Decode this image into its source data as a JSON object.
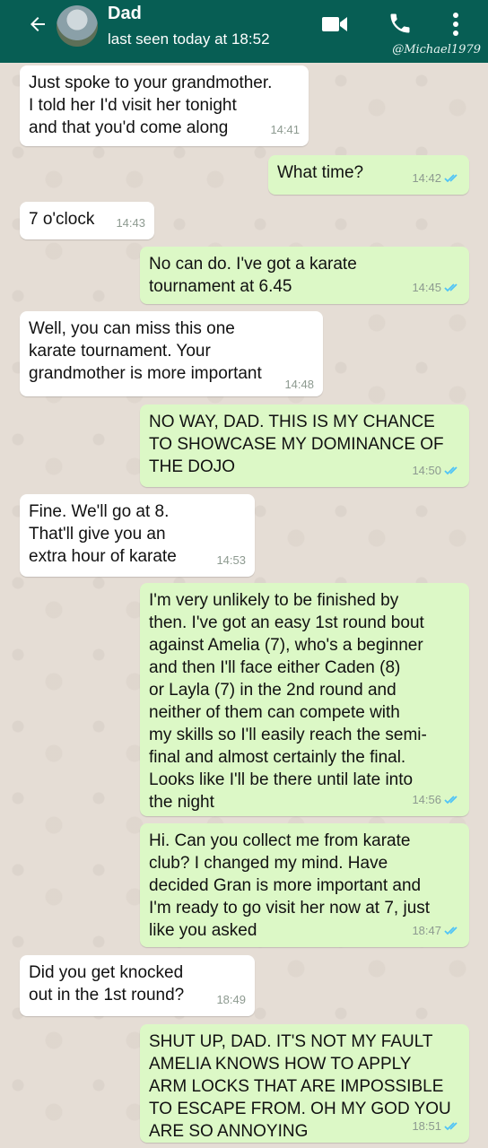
{
  "header": {
    "contact_name": "Dad",
    "status": "last seen today at 18:52",
    "watermark": "@Michael1979",
    "icons": [
      "back-arrow-icon",
      "avatar",
      "video-call-icon",
      "phone-icon",
      "more-options-icon"
    ]
  },
  "colors": {
    "header_bg": "#075e54",
    "chat_bg": "#e5ddd5",
    "incoming_bubble": "#ffffff",
    "outgoing_bubble": "#dcf8c6",
    "read_ticks": "#4fc3f7"
  },
  "messages": [
    {
      "dir": "in",
      "text": "Just spoke to your grandmother.\nI told her I'd visit her tonight\nand that you'd come along",
      "time": "14:41"
    },
    {
      "dir": "out",
      "text": "What time?",
      "time": "14:42",
      "read": true
    },
    {
      "dir": "in",
      "text": "7 o'clock",
      "time": "14:43"
    },
    {
      "dir": "out",
      "text": "No can do. I've got a karate\ntournament at 6.45",
      "time": "14:45",
      "read": true
    },
    {
      "dir": "in",
      "text": "Well, you can miss this one\nkarate tournament. Your\ngrandmother is more important",
      "time": "14:48"
    },
    {
      "dir": "out",
      "text": "NO WAY, DAD. THIS IS MY CHANCE\nTO SHOWCASE MY DOMINANCE OF\nTHE DOJO",
      "time": "14:50",
      "read": true
    },
    {
      "dir": "in",
      "text": "Fine. We'll go at 8.\nThat'll give you an\nextra hour of karate",
      "time": "14:53"
    },
    {
      "dir": "out",
      "text": "I'm very unlikely to be finished by\nthen. I've got an easy 1st round bout\nagainst Amelia (7), who's a beginner\nand then I'll face either Caden (8)\nor Layla (7) in the 2nd round and\nneither of them can compete with\nmy skills so I'll easily reach the semi-\nfinal and almost certainly the final.\nLooks like I'll be there until late into\nthe night",
      "time": "14:56",
      "read": true
    },
    {
      "dir": "out",
      "text": "Hi. Can you collect me from karate\nclub? I changed my mind. Have\ndecided Gran is more important and\nI'm ready to go visit her now at 7, just\nlike you asked",
      "time": "18:47",
      "read": true
    },
    {
      "dir": "in",
      "text": "Did you get knocked\nout in the 1st round?",
      "time": "18:49"
    },
    {
      "dir": "out",
      "text": "SHUT UP, DAD. IT'S NOT MY FAULT\nAMELIA KNOWS HOW TO APPLY\nARM LOCKS THAT ARE IMPOSSIBLE\nTO ESCAPE FROM. OH MY GOD YOU\nARE SO ANNOYING",
      "time": "18:51",
      "read": true
    }
  ]
}
